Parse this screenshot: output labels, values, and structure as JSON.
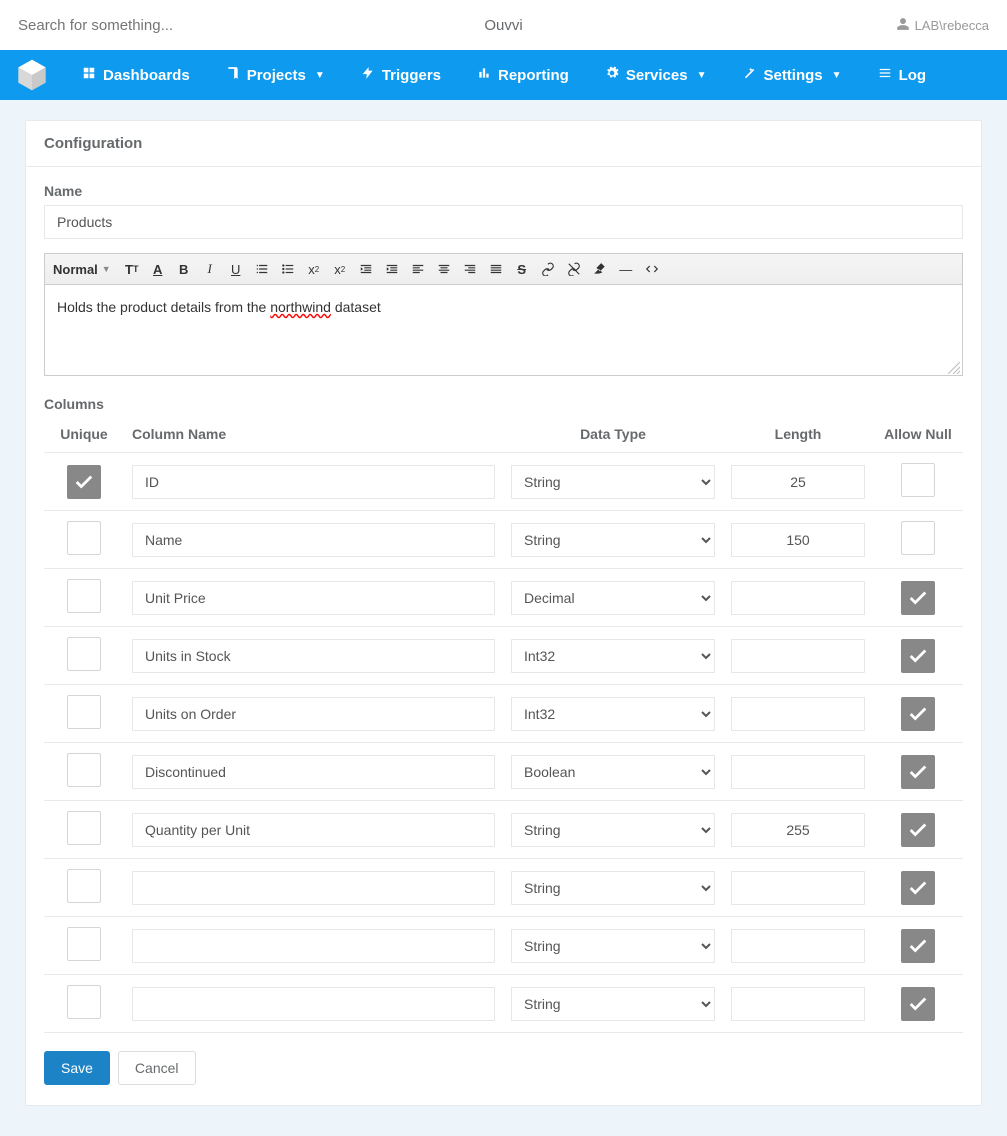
{
  "topbar": {
    "search_placeholder": "Search for something...",
    "app_title": "Ouvvi",
    "user_label": "LAB\\rebecca"
  },
  "nav": {
    "dashboards": "Dashboards",
    "projects": "Projects",
    "triggers": "Triggers",
    "reporting": "Reporting",
    "services": "Services",
    "settings": "Settings",
    "log": "Log"
  },
  "panel": {
    "title": "Configuration",
    "name_label": "Name",
    "name_value": "Products",
    "rte_format_label": "Normal",
    "description_prefix": "Holds the product details from the ",
    "description_misspell": "northwind",
    "description_suffix": " dataset",
    "columns_label": "Columns"
  },
  "columns": {
    "headers": {
      "unique": "Unique",
      "name": "Column Name",
      "type": "Data Type",
      "length": "Length",
      "allow_null": "Allow Null"
    },
    "rows": [
      {
        "unique": true,
        "name": "ID",
        "type": "String",
        "length": "25",
        "allow_null": false
      },
      {
        "unique": false,
        "name": "Name",
        "type": "String",
        "length": "150",
        "allow_null": false
      },
      {
        "unique": false,
        "name": "Unit Price",
        "type": "Decimal",
        "length": "",
        "allow_null": true
      },
      {
        "unique": false,
        "name": "Units in Stock",
        "type": "Int32",
        "length": "",
        "allow_null": true
      },
      {
        "unique": false,
        "name": "Units on Order",
        "type": "Int32",
        "length": "",
        "allow_null": true
      },
      {
        "unique": false,
        "name": "Discontinued",
        "type": "Boolean",
        "length": "",
        "allow_null": true
      },
      {
        "unique": false,
        "name": "Quantity per Unit",
        "type": "String",
        "length": "255",
        "allow_null": true
      },
      {
        "unique": false,
        "name": "",
        "type": "String",
        "length": "",
        "allow_null": true
      },
      {
        "unique": false,
        "name": "",
        "type": "String",
        "length": "",
        "allow_null": true
      },
      {
        "unique": false,
        "name": "",
        "type": "String",
        "length": "",
        "allow_null": true
      }
    ],
    "type_options": [
      "String",
      "Decimal",
      "Int32",
      "Boolean"
    ]
  },
  "buttons": {
    "save": "Save",
    "cancel": "Cancel"
  }
}
